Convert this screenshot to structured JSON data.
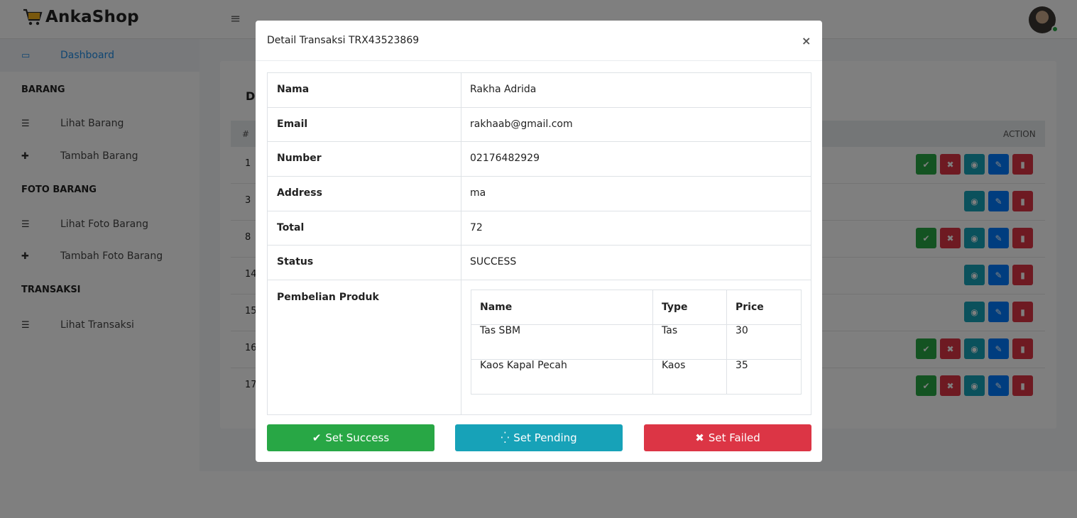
{
  "app": {
    "brand": "AnkaShop"
  },
  "sidebar": {
    "dashboard": "Dashboard",
    "sections": [
      {
        "title": "BARANG",
        "items": [
          "Lihat Barang",
          "Tambah Barang"
        ]
      },
      {
        "title": "FOTO BARANG",
        "items": [
          "Lihat Foto Barang",
          "Tambah Foto Barang"
        ]
      },
      {
        "title": "TRANSAKSI",
        "items": [
          "Lihat Transaksi"
        ]
      }
    ]
  },
  "background_table": {
    "title": "D",
    "head_hash": "#",
    "head_action": "ACTION",
    "rows": [
      "1",
      "3",
      "8",
      "14",
      "15",
      "16",
      "17"
    ]
  },
  "modal": {
    "title": "Detail Transaksi TRX43523869",
    "close": "×",
    "fields": [
      {
        "key": "Nama",
        "value": "Rakha Adrida"
      },
      {
        "key": "Email",
        "value": "rakhaab@gmail.com"
      },
      {
        "key": "Number",
        "value": "02176482929"
      },
      {
        "key": "Address",
        "value": "ma"
      },
      {
        "key": "Total",
        "value": "72"
      },
      {
        "key": "Status",
        "value": "SUCCESS"
      }
    ],
    "products_label": "Pembelian Produk",
    "products": {
      "headers": [
        "Name",
        "Type",
        "Price"
      ],
      "rows": [
        [
          "Tas SBM",
          "Tas",
          "30"
        ],
        [
          "Kaos Kapal Pecah",
          "Kaos",
          "35"
        ]
      ]
    },
    "buttons": {
      "success": "Set Success",
      "pending": "Set Pending",
      "failed": "Set Failed"
    }
  },
  "colors": {
    "success": "#28a745",
    "pending": "#17a2b8",
    "failed": "#dc3545",
    "link": "#1f8de6"
  }
}
